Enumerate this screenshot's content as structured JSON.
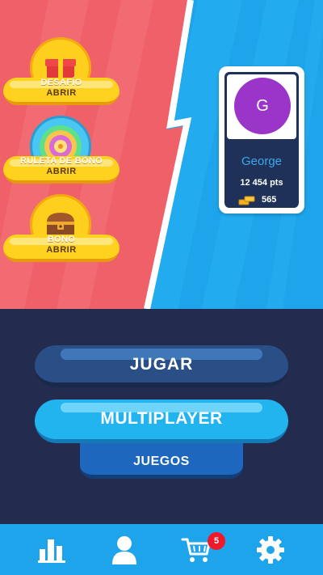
{
  "rewards": [
    {
      "title": "DESAFÍO",
      "action": "ABRIR",
      "icon": "gift-icon"
    },
    {
      "title": "RULETA DE BONO",
      "action": "ABRIR",
      "icon": "bonus-wheel-icon"
    },
    {
      "title": "BONO",
      "action": "ABRIR",
      "icon": "treasure-chest-icon"
    }
  ],
  "profile": {
    "initial": "G",
    "name": "George",
    "points": "12 454 pts",
    "coins": "565"
  },
  "buttons": {
    "play": "JUGAR",
    "multiplayer": "MULTIPLAYER",
    "games": "JUEGOS"
  },
  "nav": {
    "items": [
      "stats-icon",
      "profile-icon",
      "cart-icon",
      "settings-icon"
    ],
    "cart_badge": "5"
  },
  "colors": {
    "left_panel": "#f06068",
    "right_panel": "#1ea4ea",
    "avatar": "#9b35c9",
    "accent_yellow": "#ffd21f"
  }
}
